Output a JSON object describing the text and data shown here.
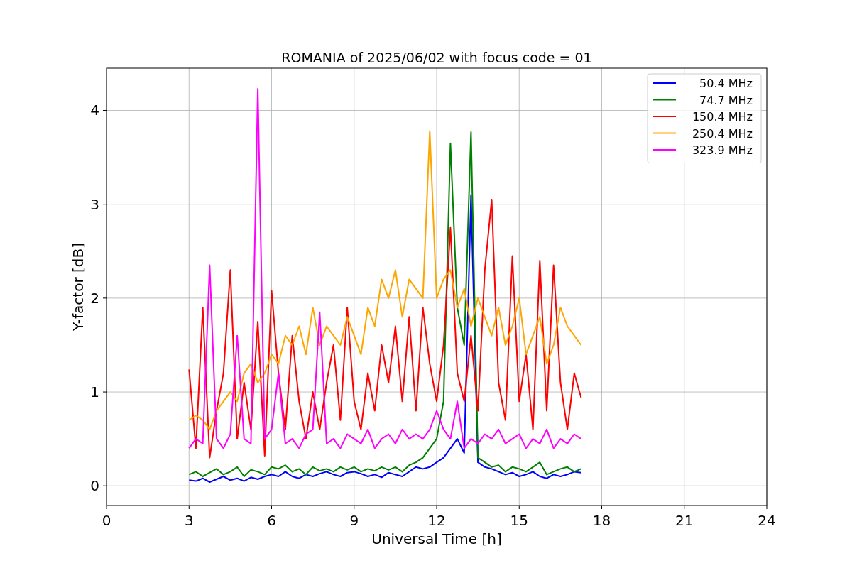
{
  "chart": {
    "chart_data": {
      "type": "line",
      "title": "ROMANIA of 2025/06/02 with focus code = 01",
      "xlabel": "Universal Time [h]",
      "ylabel": "Y-factor [dB]",
      "x": [
        3,
        3.25,
        3.5,
        3.75,
        4,
        4.25,
        4.5,
        4.75,
        5,
        5.25,
        5.5,
        5.75,
        6,
        6.25,
        6.5,
        6.75,
        7,
        7.25,
        7.5,
        7.75,
        8,
        8.25,
        8.5,
        8.75,
        9,
        9.25,
        9.5,
        9.75,
        10,
        10.25,
        10.5,
        10.75,
        11,
        11.25,
        11.5,
        11.75,
        12,
        12.25,
        12.5,
        12.75,
        13,
        13.25,
        13.5,
        13.75,
        14,
        14.25,
        14.5,
        14.75,
        15,
        15.25,
        15.5,
        15.75,
        16,
        16.25,
        16.5,
        16.75,
        17,
        17.25
      ],
      "series": [
        {
          "name": "50.4 MHz",
          "color": "#0000ff",
          "values": [
            0.06,
            0.05,
            0.08,
            0.04,
            0.07,
            0.1,
            0.06,
            0.08,
            0.05,
            0.09,
            0.07,
            0.1,
            0.12,
            0.1,
            0.15,
            0.1,
            0.08,
            0.12,
            0.1,
            0.13,
            0.15,
            0.12,
            0.1,
            0.14,
            0.15,
            0.13,
            0.1,
            0.12,
            0.09,
            0.14,
            0.12,
            0.1,
            0.15,
            0.2,
            0.18,
            0.2,
            0.25,
            0.3,
            0.4,
            0.5,
            0.35,
            3.1,
            0.25,
            0.2,
            0.18,
            0.15,
            0.12,
            0.14,
            0.1,
            0.12,
            0.15,
            0.1,
            0.08,
            0.12,
            0.1,
            0.12,
            0.15,
            0.14
          ]
        },
        {
          "name": "74.7 MHz",
          "color": "#008000",
          "values": [
            0.12,
            0.15,
            0.1,
            0.14,
            0.18,
            0.12,
            0.15,
            0.2,
            0.1,
            0.17,
            0.15,
            0.12,
            0.2,
            0.18,
            0.22,
            0.15,
            0.18,
            0.12,
            0.2,
            0.16,
            0.18,
            0.15,
            0.2,
            0.17,
            0.2,
            0.15,
            0.18,
            0.16,
            0.2,
            0.17,
            0.2,
            0.15,
            0.22,
            0.25,
            0.3,
            0.4,
            0.5,
            0.9,
            3.65,
            1.9,
            1.5,
            3.77,
            0.3,
            0.25,
            0.2,
            0.22,
            0.15,
            0.2,
            0.18,
            0.15,
            0.2,
            0.25,
            0.12,
            0.15,
            0.18,
            0.2,
            0.15,
            0.18
          ]
        },
        {
          "name": "150.4 MHz",
          "color": "#ff0000",
          "values": [
            1.24,
            0.4,
            1.9,
            0.3,
            0.8,
            1.2,
            2.3,
            0.5,
            1.1,
            0.6,
            1.75,
            0.32,
            2.08,
            1.2,
            0.6,
            1.6,
            0.9,
            0.5,
            1.0,
            0.6,
            1.1,
            1.5,
            0.7,
            1.9,
            0.9,
            0.6,
            1.2,
            0.8,
            1.5,
            1.1,
            1.7,
            0.9,
            1.8,
            0.8,
            1.9,
            1.3,
            0.9,
            1.5,
            2.75,
            1.2,
            0.9,
            1.6,
            0.8,
            2.3,
            3.05,
            1.1,
            0.7,
            2.45,
            0.9,
            1.4,
            0.6,
            2.4,
            0.8,
            2.35,
            1.1,
            0.6,
            1.2,
            0.94
          ]
        },
        {
          "name": "250.4 MHz",
          "color": "#ffa500",
          "values": [
            0.7,
            0.75,
            0.7,
            0.6,
            0.8,
            0.9,
            1.0,
            0.9,
            1.2,
            1.3,
            1.1,
            1.2,
            1.4,
            1.3,
            1.6,
            1.5,
            1.7,
            1.4,
            1.9,
            1.5,
            1.7,
            1.6,
            1.5,
            1.8,
            1.6,
            1.4,
            1.9,
            1.7,
            2.2,
            2.0,
            2.3,
            1.8,
            2.2,
            2.1,
            2.0,
            3.78,
            2.0,
            2.2,
            2.3,
            1.9,
            2.1,
            1.7,
            2.0,
            1.8,
            1.6,
            1.9,
            1.5,
            1.7,
            2.0,
            1.4,
            1.6,
            1.8,
            1.3,
            1.5,
            1.9,
            1.7,
            1.6,
            1.5
          ]
        },
        {
          "name": "323.9 MHz",
          "color": "#ff00ff",
          "values": [
            0.4,
            0.5,
            0.45,
            2.35,
            0.5,
            0.4,
            0.55,
            1.6,
            0.5,
            0.45,
            4.23,
            0.5,
            0.6,
            1.2,
            0.45,
            0.5,
            0.4,
            0.55,
            0.6,
            1.85,
            0.45,
            0.5,
            0.4,
            0.55,
            0.5,
            0.45,
            0.6,
            0.4,
            0.5,
            0.55,
            0.45,
            0.6,
            0.5,
            0.55,
            0.5,
            0.6,
            0.8,
            0.6,
            0.5,
            0.9,
            0.4,
            0.5,
            0.45,
            0.55,
            0.5,
            0.6,
            0.45,
            0.5,
            0.55,
            0.4,
            0.5,
            0.45,
            0.6,
            0.4,
            0.5,
            0.45,
            0.55,
            0.5
          ]
        }
      ],
      "grid": true,
      "legend": true,
      "xlim": [
        0,
        24
      ],
      "ylim": [
        -0.21,
        4.45
      ],
      "xticks": [
        0,
        3,
        6,
        9,
        12,
        15,
        18,
        21,
        24
      ],
      "yticks": [
        0,
        1,
        2,
        3,
        4
      ]
    }
  }
}
